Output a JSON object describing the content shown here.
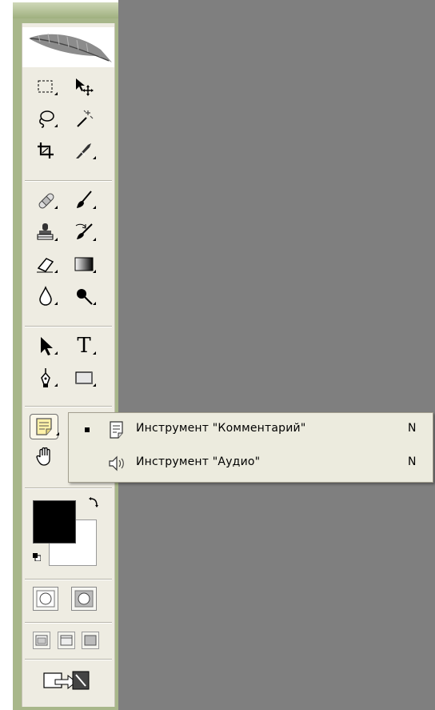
{
  "popup": {
    "items": [
      {
        "label": "Инструмент \"Комментарий\"",
        "shortcut": "N",
        "selected": true,
        "icon": "note-icon"
      },
      {
        "label": "Инструмент \"Аудио\"",
        "shortcut": "N",
        "selected": false,
        "icon": "audio-icon"
      }
    ]
  },
  "toolbox": {
    "text_tool_glyph": "T",
    "foreground_color": "#000000",
    "background_color": "#ffffff"
  }
}
